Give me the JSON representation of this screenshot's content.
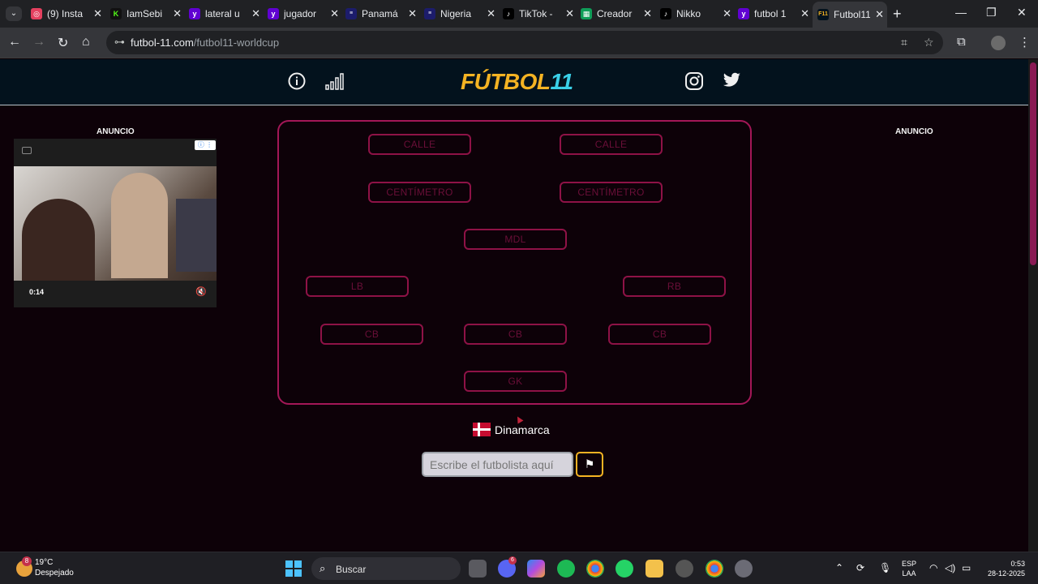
{
  "browser": {
    "tabs": [
      {
        "title": "(9) Insta",
        "icon": "instagram-icon",
        "color": "#e4405f"
      },
      {
        "title": "IamSebi",
        "icon": "kick-icon",
        "color": "#53fc18"
      },
      {
        "title": "lateral u",
        "icon": "yahoo-icon",
        "color": "#6001d2"
      },
      {
        "title": "jugador",
        "icon": "yahoo-icon",
        "color": "#6001d2"
      },
      {
        "title": "Panamá",
        "icon": "espn-icon",
        "color": "#1c1c6b"
      },
      {
        "title": "Nigeria",
        "icon": "espn-icon",
        "color": "#1c1c6b"
      },
      {
        "title": "TikTok -",
        "icon": "tiktok-icon",
        "color": "#000000"
      },
      {
        "title": "Creador",
        "icon": "sheets-icon",
        "color": "#0f9d58"
      },
      {
        "title": "Nikko",
        "icon": "tiktok-icon",
        "color": "#000000"
      },
      {
        "title": "futbol 1",
        "icon": "yahoo-icon",
        "color": "#6001d2"
      },
      {
        "title": "Futbol11",
        "icon": "futbol11-icon",
        "color": "#03121d"
      }
    ],
    "url_domain": "futbol-11.com",
    "url_path": "/futbol11-worldcup"
  },
  "ads": {
    "left_label": "ANUNCIO",
    "right_label": "ANUNCIO",
    "video_time": "0:14"
  },
  "logo": {
    "part1": "FÚTBOL",
    "part2": "11"
  },
  "positions": {
    "st_left": "CALLE",
    "st_right": "CALLE",
    "cm_left": "CENTÍMETRO",
    "cm_right": "CENTÍMETRO",
    "mdl": "MDL",
    "lb": "LB",
    "rb": "RB",
    "cb_left": "CB",
    "cb_center": "CB",
    "cb_right": "CB",
    "gk": "GK"
  },
  "country": "Dinamarca",
  "guess": {
    "placeholder": "Escribe el futbolista aquí"
  },
  "taskbar": {
    "temperature": "19°C",
    "weather": "Despejado",
    "weather_badge": "8",
    "search_label": "Buscar",
    "language": "ESP",
    "language_sub": "LAA",
    "time": "0:53",
    "date": "28-12-2025",
    "discord_badge": "6"
  }
}
